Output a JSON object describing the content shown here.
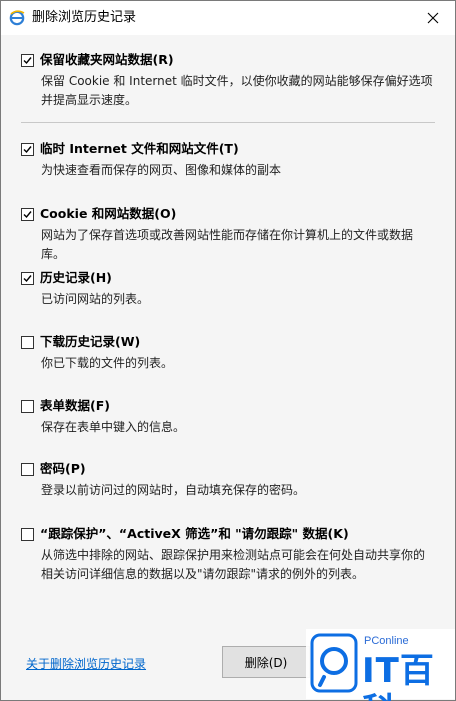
{
  "window": {
    "title": "删除浏览历史记录"
  },
  "options": [
    {
      "label": "保留收藏夹网站数据(R)",
      "checked": true,
      "description": "保留 Cookie 和 Internet 临时文件，以使你收藏的网站能够保存偏好选项并提高显示速度。"
    },
    {
      "label": "临时 Internet 文件和网站文件(T)",
      "checked": true,
      "description": "为快速查看而保存的网页、图像和媒体的副本"
    },
    {
      "label": "Cookie 和网站数据(O)",
      "checked": true,
      "description": "网站为了保存首选项或改善网站性能而存储在你计算机上的文件或数据库。"
    },
    {
      "label": "历史记录(H)",
      "checked": true,
      "description": "已访问网站的列表。"
    },
    {
      "label": "下载历史记录(W)",
      "checked": false,
      "description": "你已下载的文件的列表。"
    },
    {
      "label": "表单数据(F)",
      "checked": false,
      "description": "保存在表单中键入的信息。"
    },
    {
      "label": "密码(P)",
      "checked": false,
      "description": "登录以前访问过的网站时，自动填充保存的密码。"
    },
    {
      "label": "“跟踪保护”、“ActiveX 筛选”和 \"请勿跟踪\" 数据(K)",
      "checked": false,
      "description": "从筛选中排除的网站、跟踪保护用来检测站点可能会在何处自动共享你的相关访问详细信息的数据以及\"请勿跟踪\"请求的例外的列表。"
    }
  ],
  "footer": {
    "about_link": "关于删除浏览历史记录",
    "delete_button": "删除(D)"
  },
  "watermark": {
    "small_text": "PConline",
    "big_text": "IT百科"
  },
  "colors": {
    "link": "#0066cc",
    "watermark": "#0d6ee3",
    "dialog_bg": "#f5f5f5"
  }
}
